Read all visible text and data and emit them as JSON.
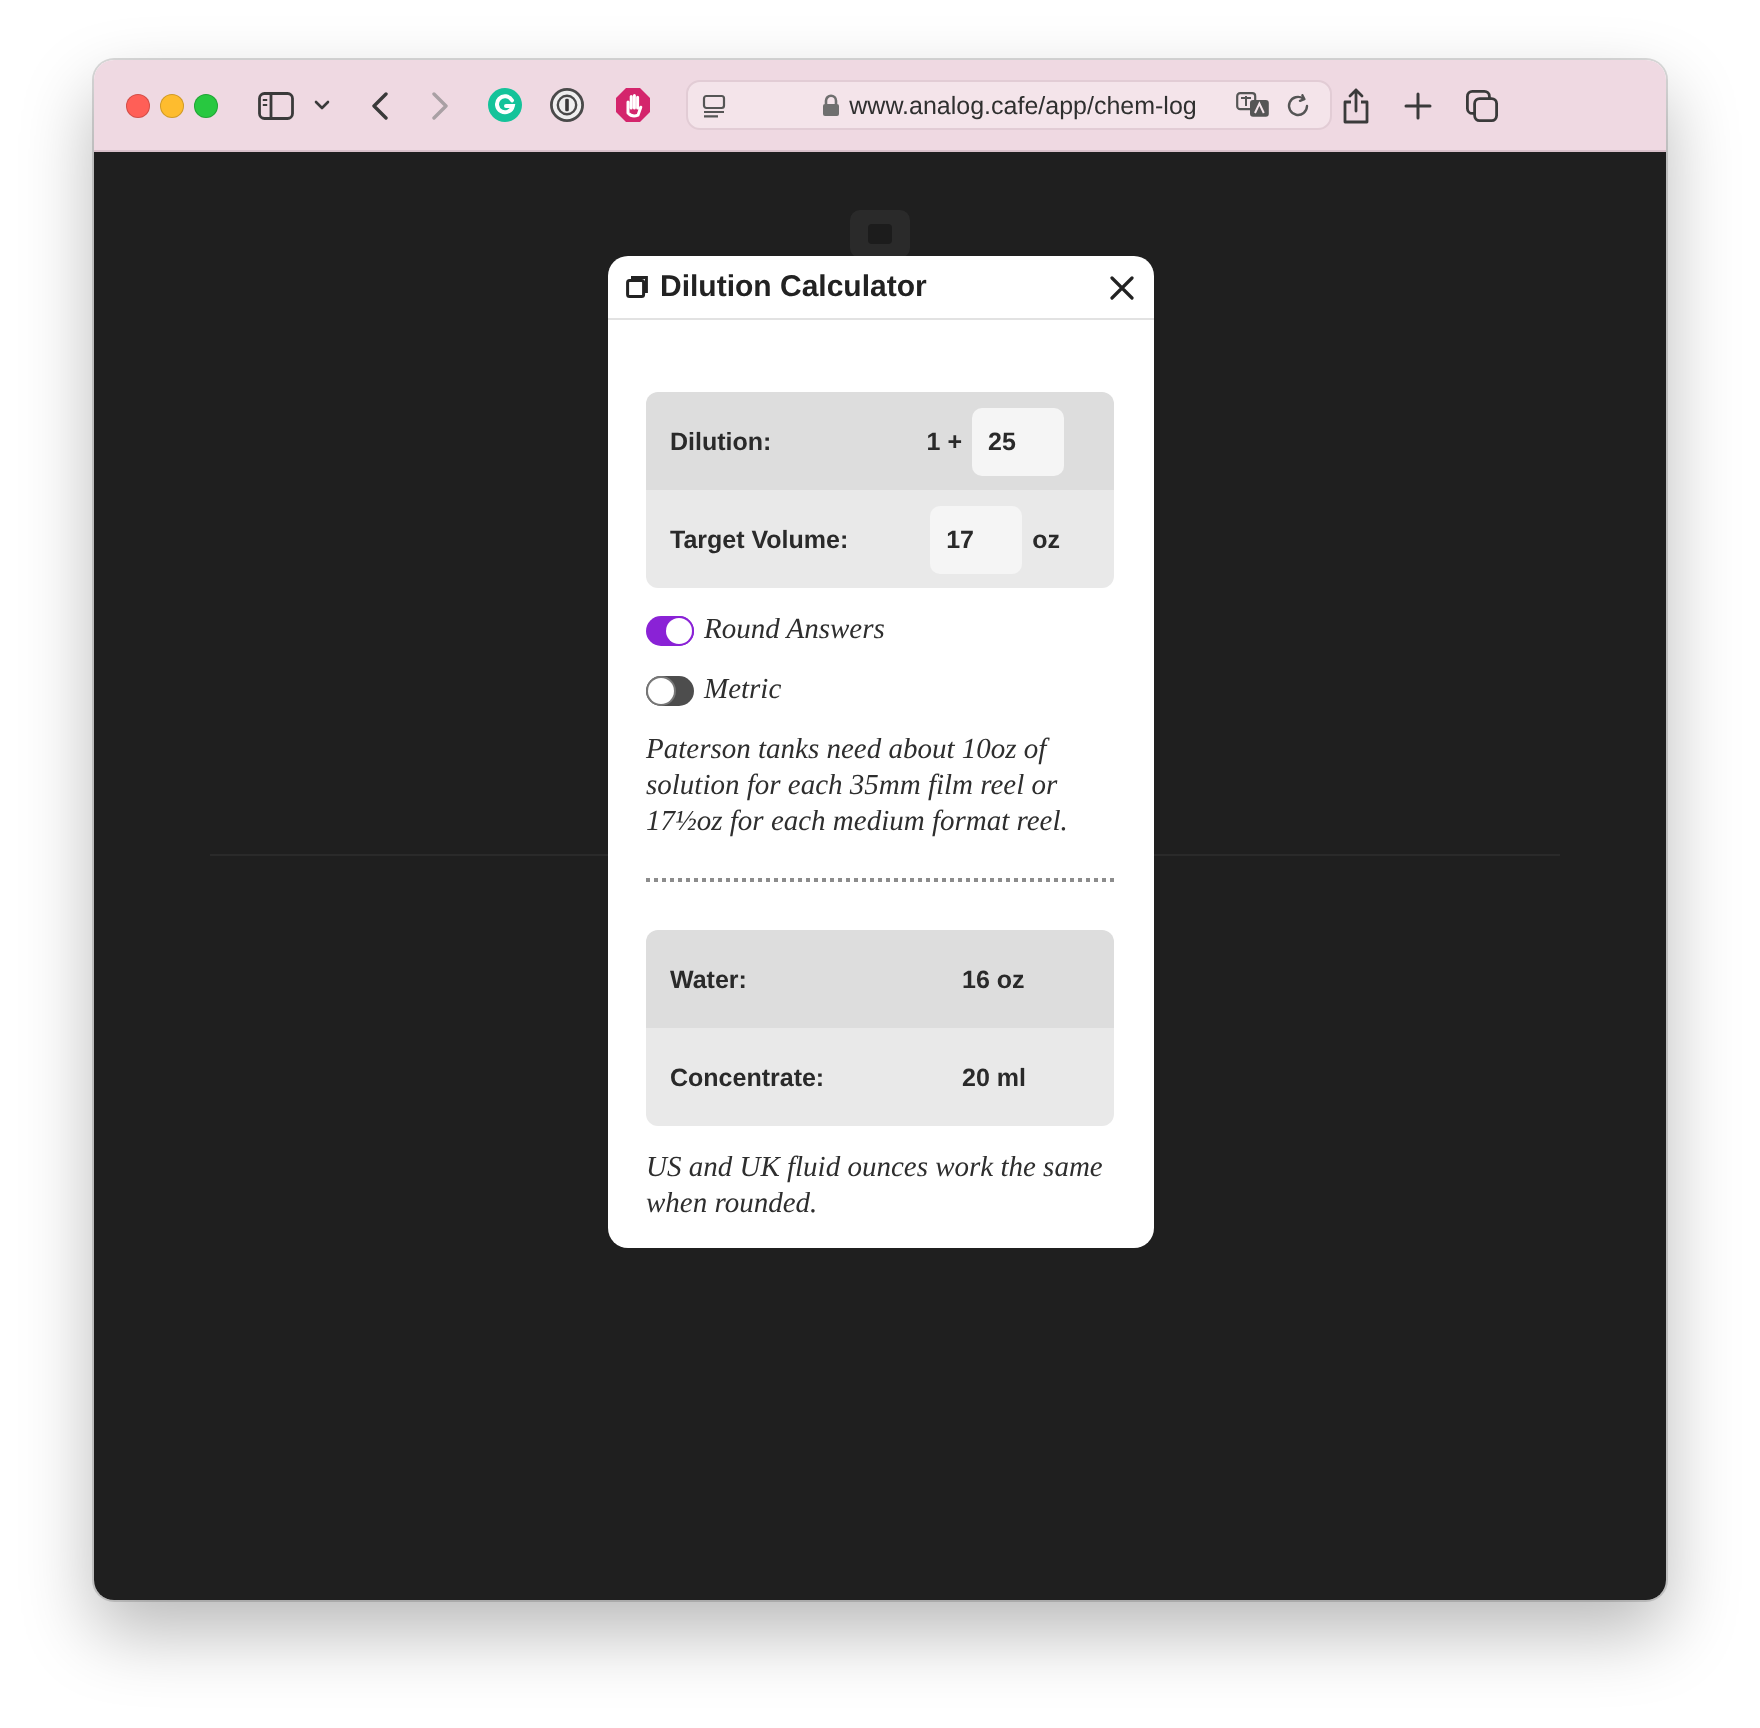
{
  "browser": {
    "nav": [
      {
        "kind": "back",
        "disabled": false
      },
      {
        "kind": "forward",
        "disabled": true
      }
    ],
    "url": "www.analog.cafe/app/chem-log"
  },
  "dialog": {
    "title": "Dilution Calculator",
    "inputs": [
      {
        "kind": "ratio",
        "label": "Dilution:",
        "prefix": "1 +",
        "value": "25"
      },
      {
        "kind": "volume",
        "label": "Target Volume:",
        "value": "17",
        "suffix": "oz"
      }
    ],
    "toggles": [
      {
        "label": "Round Answers",
        "on": true
      },
      {
        "label": "Metric",
        "on": false
      }
    ],
    "note": "Paterson tanks need about 10oz of solution for each 35mm film reel or 17½oz for each medium format reel.",
    "results": [
      {
        "label": "Water:",
        "value": "16 oz"
      },
      {
        "label": "Concentrate:",
        "value": "20 ml"
      }
    ],
    "footnote": "US and UK fluid ounces work the same when rounded."
  }
}
